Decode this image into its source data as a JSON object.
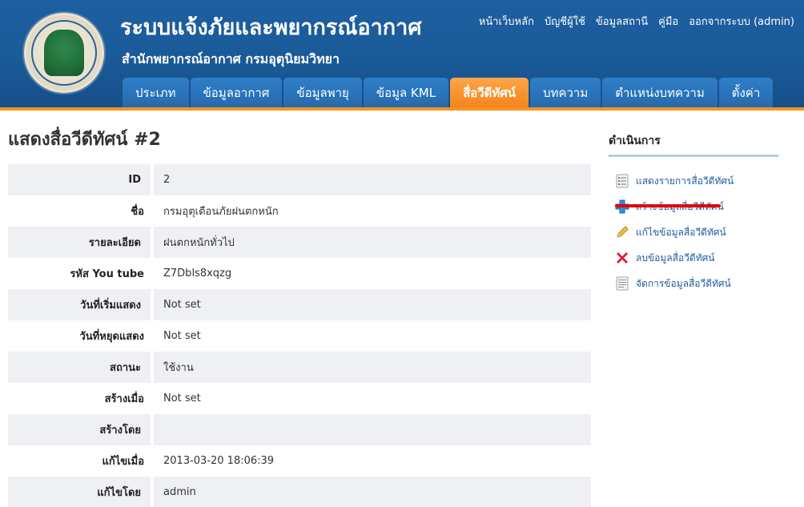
{
  "header": {
    "title": "ระบบแจ้งภัยและพยากรณ์อากาศ",
    "subtitle": "สำนักพยากรณ์อากาศ กรมอุตุนิยมวิทยา",
    "logo_text": "กรมอุตุนิยมวิทยา METEOROLOGICAL DEPARTMENT",
    "top_links": [
      "หน้าเว็บหลัก",
      "บัญชีผู้ใช้",
      "ข้อมูลสถานี",
      "คู่มือ",
      "ออกจากระบบ (admin)"
    ]
  },
  "menu": {
    "tabs": [
      "ประเภท",
      "ข้อมูลอากาศ",
      "ข้อมูลพายุ",
      "ข้อมูล KML",
      "สื่อวีดีทัศน์",
      "บทความ",
      "ตำแหน่งบทความ",
      "ตั้งค่า"
    ],
    "active": "สื่อวีดีทัศน์"
  },
  "page": {
    "title": "แสดงสื่อวีดีทัศน์ #2"
  },
  "detail": [
    {
      "label": "ID",
      "value": "2"
    },
    {
      "label": "ชื่อ",
      "value": "กรมอุตุเตือนภัยฝนตกหนัก"
    },
    {
      "label": "รายละเอียด",
      "value": "ฝนตกหนักทั่วไป"
    },
    {
      "label": "รหัส You tube",
      "value": "Z7Dbls8xqzg"
    },
    {
      "label": "วันที่เริ่มแสดง",
      "value": "Not set"
    },
    {
      "label": "วันที่หยุดแสดง",
      "value": "Not set"
    },
    {
      "label": "สถานะ",
      "value": "ใช้งาน"
    },
    {
      "label": "สร้างเมื่อ",
      "value": "Not set"
    },
    {
      "label": "สร้างโดย",
      "value": ""
    },
    {
      "label": "แก้ไขเมื่อ",
      "value": "2013-03-20 18:06:39"
    },
    {
      "label": "แก้ไขโดย",
      "value": "admin"
    }
  ],
  "sidebar": {
    "heading": "ดำเนินการ",
    "items": [
      {
        "label": "แสดงรายการสื่อวีดีทัศน์",
        "icon": "list-icon"
      },
      {
        "label": "สร้างข้อมูลสื่อวีดีทัศน์",
        "icon": "plus-icon"
      },
      {
        "label": "แก้ไขข้อมูลสื่อวีดีทัศน์",
        "icon": "pencil-icon"
      },
      {
        "label": "ลบข้อมูลสื่อวีดีทัศน์",
        "icon": "delete-icon"
      },
      {
        "label": "จัดการข้อมูลสื่อวีดีทัศน์",
        "icon": "manage-icon"
      }
    ]
  },
  "colors": {
    "header_bg": "#1a5a99",
    "active_tab": "#f3831b",
    "link": "#1f5d9e",
    "not_set": "#f0a0a8",
    "annotation_underline": "#e00000"
  }
}
